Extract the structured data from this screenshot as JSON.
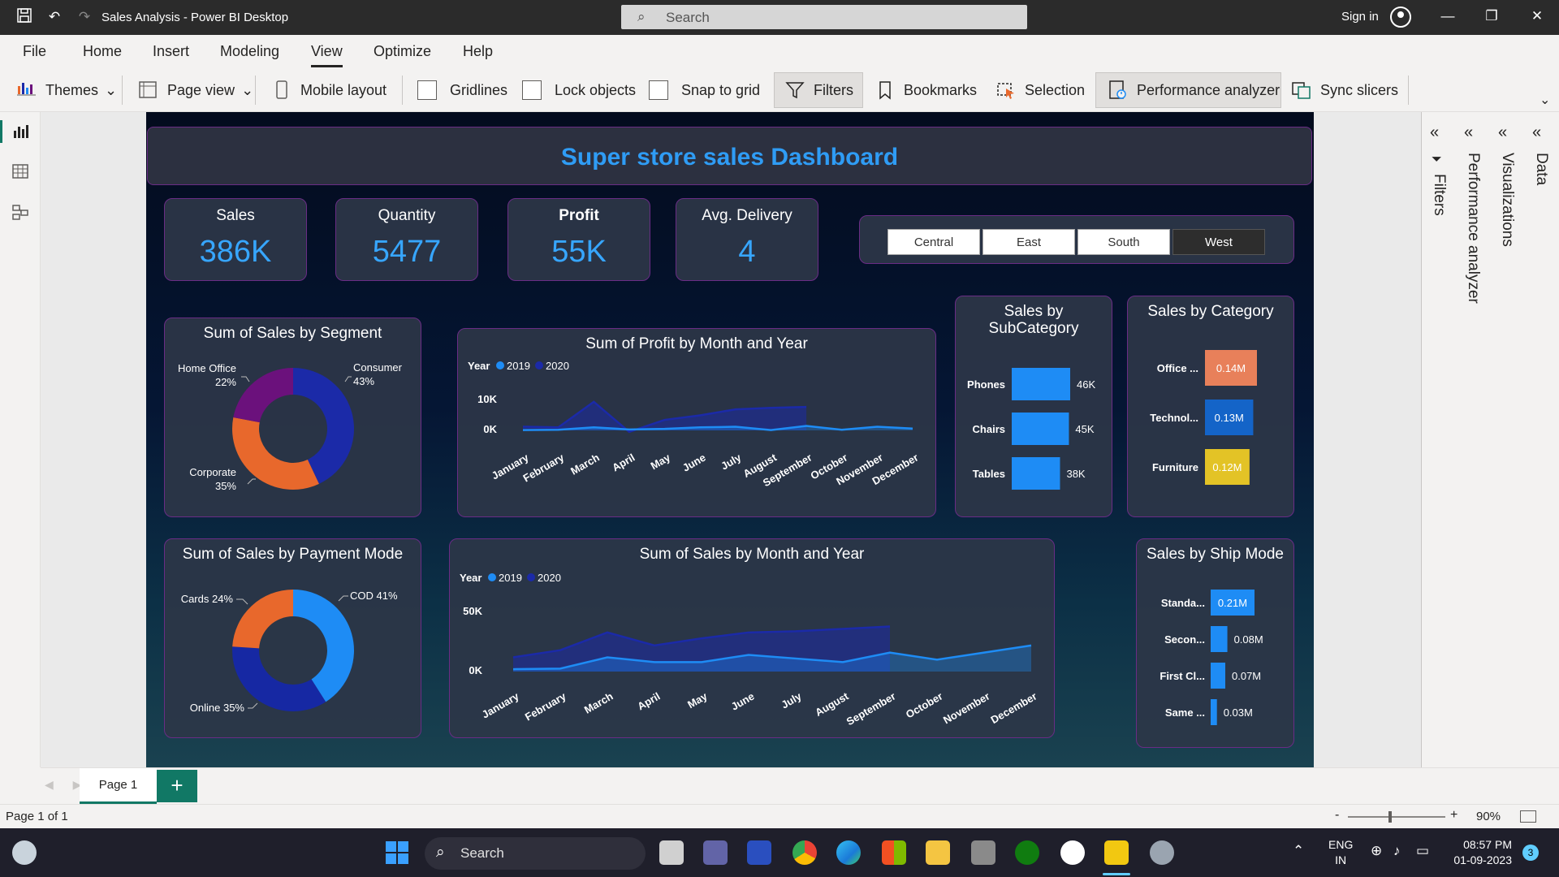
{
  "window": {
    "title": "Sales Analysis - Power BI Desktop",
    "search_placeholder": "Search",
    "sign_in": "Sign in"
  },
  "menu": [
    "File",
    "Home",
    "Insert",
    "Modeling",
    "View",
    "Optimize",
    "Help"
  ],
  "ribbon": {
    "themes": "Themes",
    "page_view": "Page view",
    "mobile_layout": "Mobile layout",
    "gridlines": "Gridlines",
    "lock_objects": "Lock objects",
    "snap_to_grid": "Snap to grid",
    "filters": "Filters",
    "bookmarks": "Bookmarks",
    "selection": "Selection",
    "performance_analyzer": "Performance analyzer",
    "sync_slicers": "Sync slicers"
  },
  "dashboard": {
    "title": "Super store sales Dashboard",
    "kpis": [
      {
        "label": "Sales",
        "value": "386K"
      },
      {
        "label": "Quantity",
        "value": "5477"
      },
      {
        "label": "Profit",
        "value": "55K"
      },
      {
        "label": "Avg. Delivery",
        "value": "4"
      }
    ],
    "region_slicer": {
      "options": [
        "Central",
        "East",
        "South",
        "West"
      ],
      "selected": "West"
    },
    "segment_donut": {
      "title": "Sum of Sales by Segment",
      "slices": [
        {
          "label": "Consumer",
          "pct_label": "43%",
          "value": 43,
          "color": "#1b2aa8"
        },
        {
          "label": "Corporate",
          "pct_label": "35%",
          "value": 35,
          "color": "#e8682c"
        },
        {
          "label": "Home Office",
          "pct_label": "22%",
          "value": 22,
          "color": "#6b117c"
        }
      ]
    },
    "payment_donut": {
      "title": "Sum of Sales by Payment Mode",
      "slices": [
        {
          "label": "COD 41%",
          "value": 41,
          "color": "#1e8cf5"
        },
        {
          "label": "Online 35%",
          "value": 35,
          "color": "#1628a3"
        },
        {
          "label": "Cards 24%",
          "value": 24,
          "color": "#e8682c"
        }
      ]
    },
    "subcategory": {
      "title_line1": "Sales by",
      "title_line2": "SubCategory",
      "bars": [
        {
          "label": "Phones",
          "value": 46,
          "value_label": "46K"
        },
        {
          "label": "Chairs",
          "value": 45,
          "value_label": "45K"
        },
        {
          "label": "Tables",
          "value": 38,
          "value_label": "38K"
        }
      ]
    },
    "category": {
      "title": "Sales by Category",
      "bars": [
        {
          "label": "Office ...",
          "value": 0.14,
          "value_label": "0.14M",
          "color": "#e8805a"
        },
        {
          "label": "Technol...",
          "value": 0.13,
          "value_label": "0.13M",
          "color": "#1464c8"
        },
        {
          "label": "Furniture",
          "value": 0.12,
          "value_label": "0.12M",
          "color": "#e3c326"
        }
      ]
    },
    "shipmode": {
      "title": "Sales by Ship Mode",
      "bars": [
        {
          "label": "Standa...",
          "value": 0.21,
          "value_label": "0.21M"
        },
        {
          "label": "Secon...",
          "value": 0.08,
          "value_label": "0.08M"
        },
        {
          "label": "First Cl...",
          "value": 0.07,
          "value_label": "0.07M"
        },
        {
          "label": "Same ...",
          "value": 0.03,
          "value_label": "0.03M"
        }
      ]
    },
    "legend": {
      "prefix": "Year",
      "y2019": "2019",
      "y2020": "2020"
    }
  },
  "chart_data": [
    {
      "type": "line",
      "title": "Sum of Profit by Month and Year",
      "categories": [
        "January",
        "February",
        "March",
        "April",
        "May",
        "June",
        "July",
        "August",
        "September",
        "October",
        "November",
        "December"
      ],
      "yticks": [
        "10K",
        "0K"
      ],
      "ylim": [
        0,
        10000
      ],
      "series": [
        {
          "name": "2019",
          "color": "#1e8cf5",
          "values": [
            100,
            200,
            1000,
            300,
            500,
            1000,
            1200,
            100,
            1500,
            200,
            1200,
            600
          ]
        },
        {
          "name": "2020",
          "color": "#1b2aa8",
          "values": [
            1200,
            1000,
            9500,
            -500,
            3500,
            5000,
            7000,
            7500,
            7800,
            null,
            null,
            null
          ]
        }
      ]
    },
    {
      "type": "area",
      "title": "Sum of Sales by Month and Year",
      "categories": [
        "January",
        "February",
        "March",
        "April",
        "May",
        "June",
        "July",
        "August",
        "September",
        "October",
        "November",
        "December"
      ],
      "yticks": [
        "50K",
        "0K"
      ],
      "ylim": [
        0,
        50000
      ],
      "series": [
        {
          "name": "2019",
          "color": "#1e8cf5",
          "values": [
            2000,
            2500,
            12000,
            8000,
            8000,
            14000,
            11000,
            8000,
            16000,
            10000,
            16000,
            22000
          ]
        },
        {
          "name": "2020",
          "color": "#1b2aa8",
          "values": [
            12000,
            18000,
            33000,
            22000,
            28000,
            33000,
            34000,
            36000,
            38000,
            null,
            null,
            null
          ]
        }
      ]
    }
  ],
  "panes": {
    "filters": "Filters",
    "performance": "Performance analyzer",
    "visualizations": "Visualizations",
    "data": "Data"
  },
  "pages": {
    "tab": "Page 1",
    "add": "+"
  },
  "status": {
    "page": "Page 1 of 1",
    "zoom": "90%"
  },
  "taskbar": {
    "search": "Search",
    "lang1": "ENG",
    "lang2": "IN",
    "time": "08:57 PM",
    "date": "01-09-2023",
    "notif": "3"
  }
}
